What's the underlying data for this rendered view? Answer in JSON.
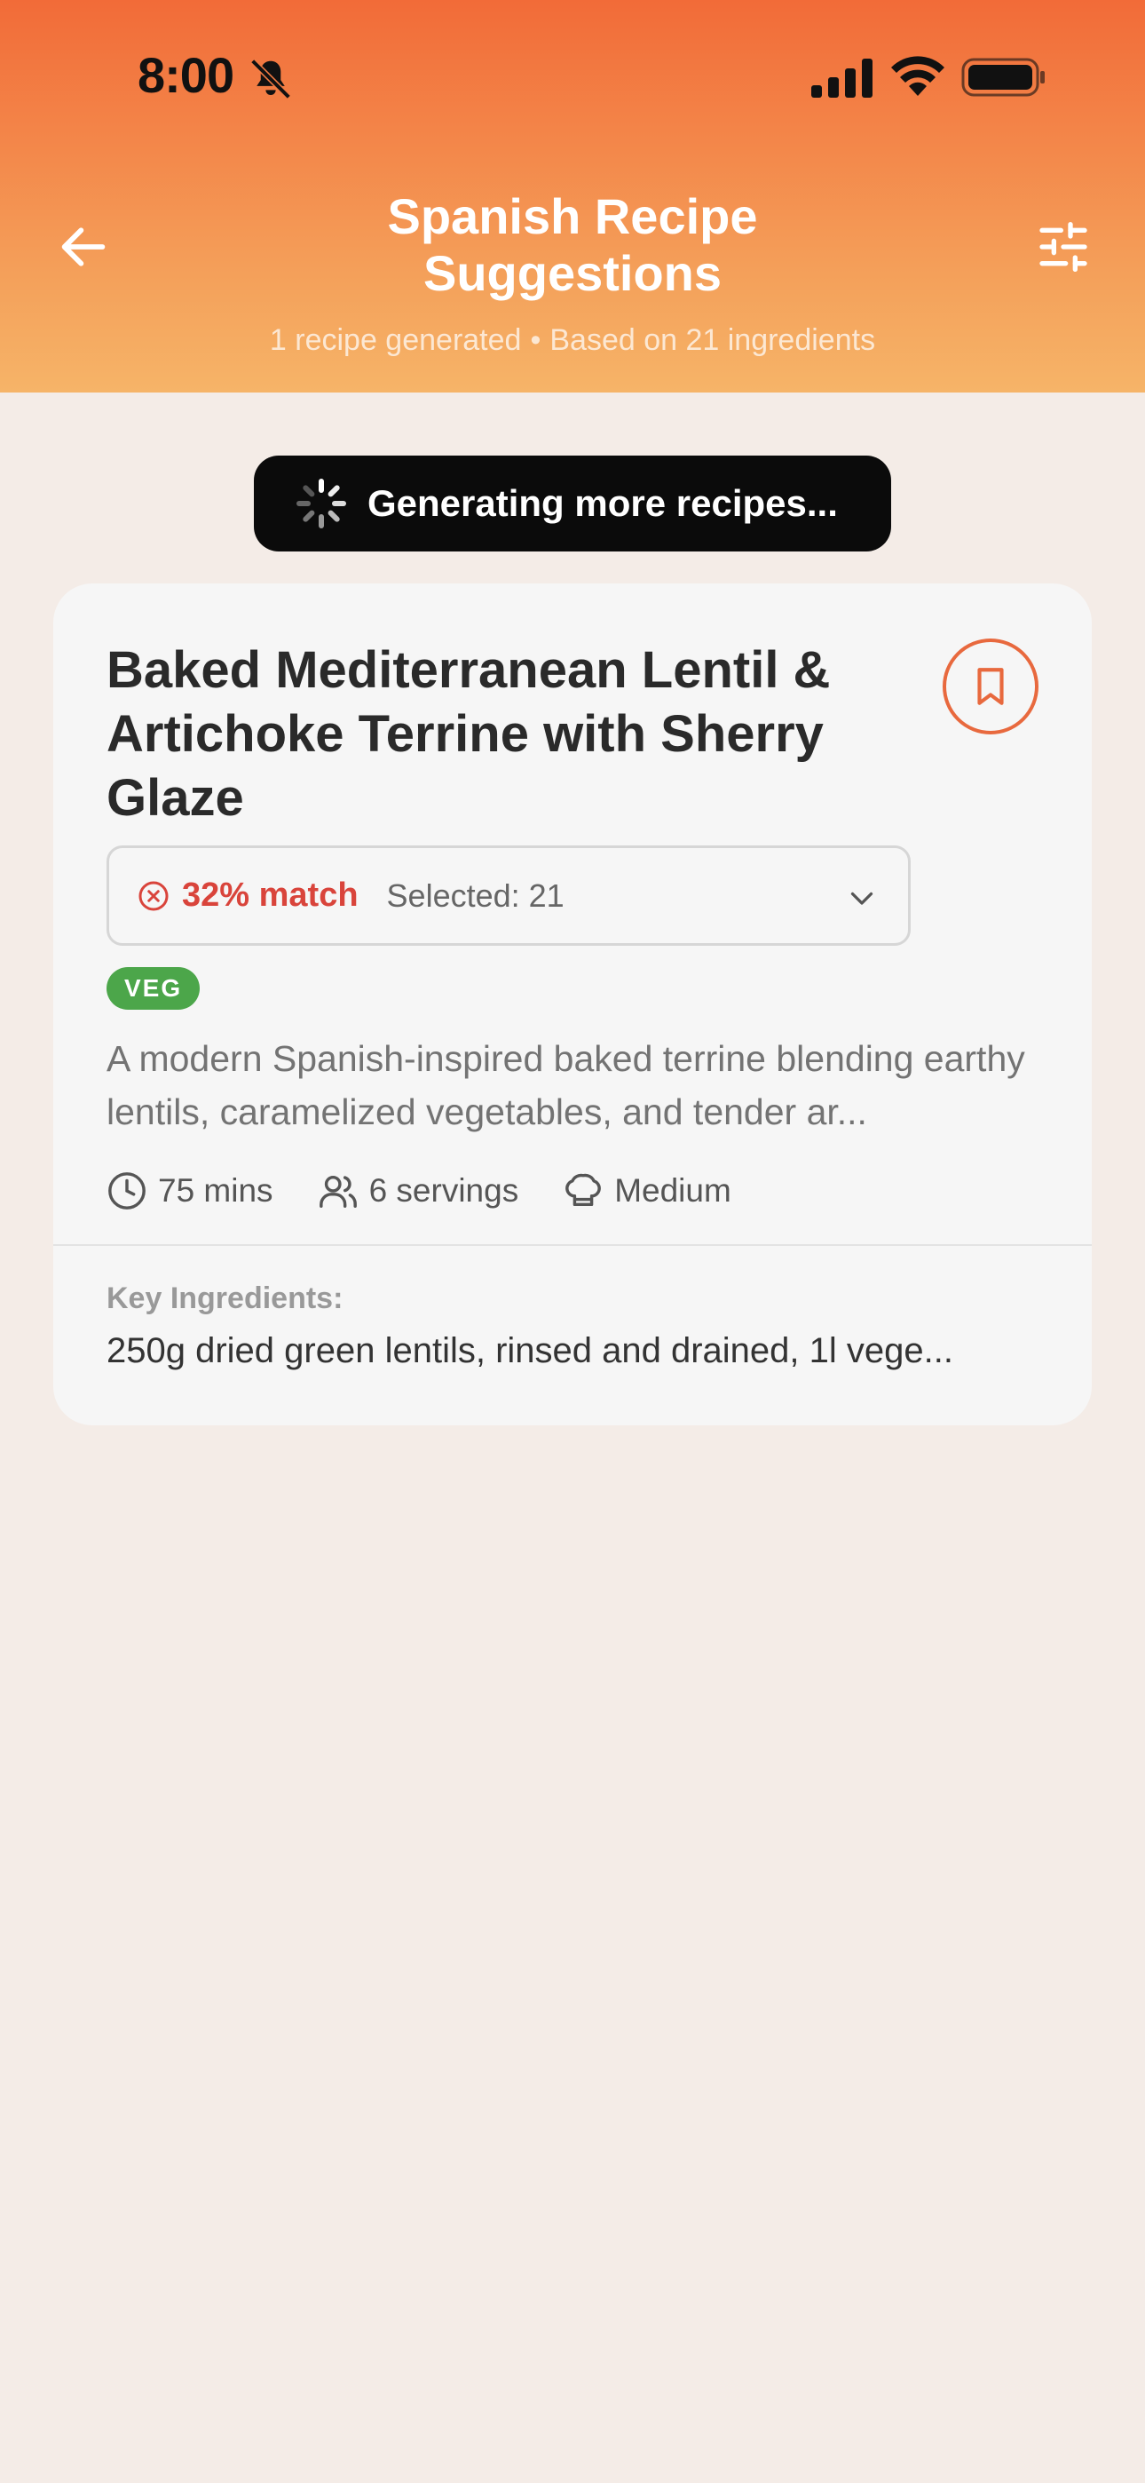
{
  "status_bar": {
    "time": "8:00",
    "icons": [
      "bell-muted-icon",
      "cellular-signal-icon",
      "wifi-icon",
      "battery-icon"
    ]
  },
  "header": {
    "title": "Spanish Recipe Suggestions",
    "subtitle_count": "1 recipe generated",
    "subtitle_separator": "•",
    "subtitle_basis": "Based on 21 ingredients",
    "back_icon": "arrow-left-icon",
    "filter_icon": "sliders-icon",
    "colors": {
      "gradient_top": "#F26B38",
      "gradient_bottom": "#F6B468"
    }
  },
  "toast": {
    "text": "Generating more recipes...",
    "icon": "spinner-icon"
  },
  "recipe": {
    "title": "Baked Mediterranean Lentil & Artichoke Terrine with Sherry Glaze",
    "match": "32% match",
    "selected": "Selected: 21",
    "badge": "VEG",
    "description": "A modern Spanish-inspired baked terrine blending earthy lentils, caramelized vegetables, and tender ar...",
    "time": "75 mins",
    "servings": "6 servings",
    "difficulty": "Medium",
    "ingredients_label": "Key Ingredients:",
    "ingredients": "250g dried green lentils, rinsed and drained, 1l vege...",
    "colors": {
      "accent": "#E8693E",
      "match_bad": "#D9443B",
      "veg": "#4CA64A"
    }
  }
}
